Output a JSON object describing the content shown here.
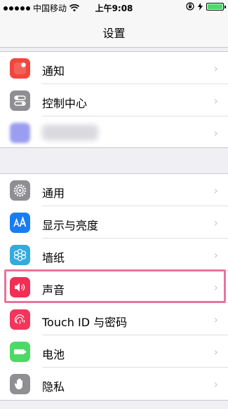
{
  "status_bar": {
    "carrier": "中国移动",
    "time": "上午9:08",
    "battery_level": 1.0,
    "icons": [
      "signal-dots-icon",
      "wifi-icon",
      "orientation-lock-icon",
      "charging-icon",
      "battery-icon"
    ]
  },
  "nav": {
    "title": "设置"
  },
  "groups": [
    {
      "items": [
        {
          "label": "通知",
          "icon": "notifications-icon",
          "color": "#f2463c"
        },
        {
          "label": "控制中心",
          "icon": "control-center-icon",
          "color": "#8e8e93"
        },
        {
          "label": "",
          "icon": "blurred-app-icon",
          "color": "#9b9ef0"
        }
      ]
    },
    {
      "items": [
        {
          "label": "通用",
          "icon": "gear-icon",
          "color": "#8e8e93"
        },
        {
          "label": "显示与亮度",
          "icon": "display-brightness-icon",
          "color": "#1a7cf2"
        },
        {
          "label": "墙纸",
          "icon": "wallpaper-icon",
          "color": "#35aadc"
        },
        {
          "label": "声音",
          "icon": "speaker-icon",
          "color": "#f22e55"
        },
        {
          "label": "Touch ID 与密码",
          "icon": "fingerprint-icon",
          "color": "#f2355b"
        },
        {
          "label": "电池",
          "icon": "battery-setting-icon",
          "color": "#4cd964"
        },
        {
          "label": "隐私",
          "icon": "hand-icon",
          "color": "#8e8e93"
        }
      ]
    }
  ],
  "highlight_color": "#e9749b"
}
